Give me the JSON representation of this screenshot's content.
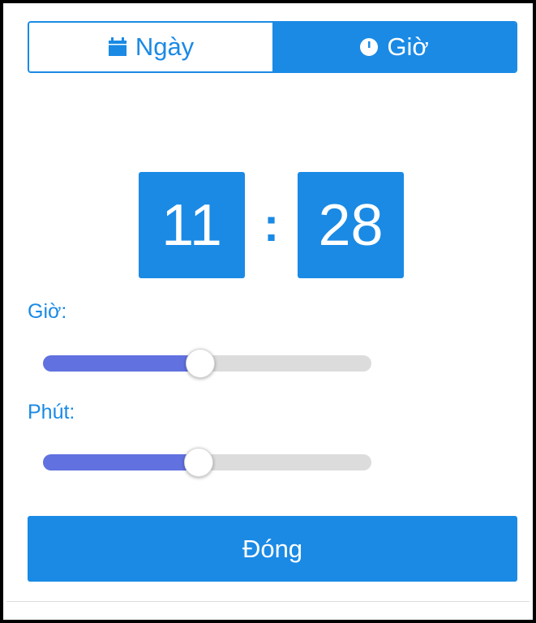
{
  "tabs": {
    "date": {
      "label": "Ngày",
      "icon": "calendar-icon"
    },
    "time": {
      "label": "Giờ",
      "icon": "clock-icon",
      "active": true
    }
  },
  "time": {
    "hour": "11",
    "separator": ":",
    "minute": "28"
  },
  "sliders": {
    "hour": {
      "label": "Giờ:",
      "value": 11,
      "min": 0,
      "max": 23
    },
    "minute": {
      "label": "Phút:",
      "value": 28,
      "min": 0,
      "max": 59
    }
  },
  "close_button": {
    "label": "Đóng"
  },
  "colors": {
    "accent": "#1a8ae5",
    "slider_fill": "#6171e0",
    "slider_track": "#dcdcdc"
  }
}
